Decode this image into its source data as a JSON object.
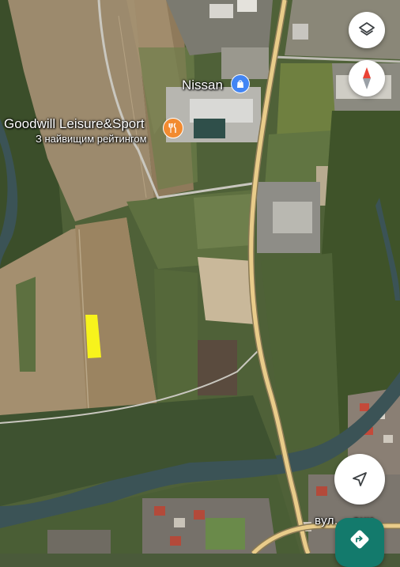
{
  "map": {
    "poi_nissan": {
      "label": "Nissan",
      "icon": "shopping-bag-icon",
      "color": "#4285F4"
    },
    "poi_goodwill": {
      "label": "Goodwill Leisure&Sport",
      "sublabel": "З найвищим рейтингом",
      "icon": "restaurant-icon",
      "color": "#F28B30"
    },
    "street_label": "вул. ...они",
    "highlight_color": "#F7F31C",
    "road_color": "#E9CC8A"
  },
  "controls": {
    "layers_icon": "layers-icon",
    "compass_icon": "compass-icon",
    "my_location_icon": "navigation-arrow-icon",
    "directions_icon": "directions-icon"
  }
}
